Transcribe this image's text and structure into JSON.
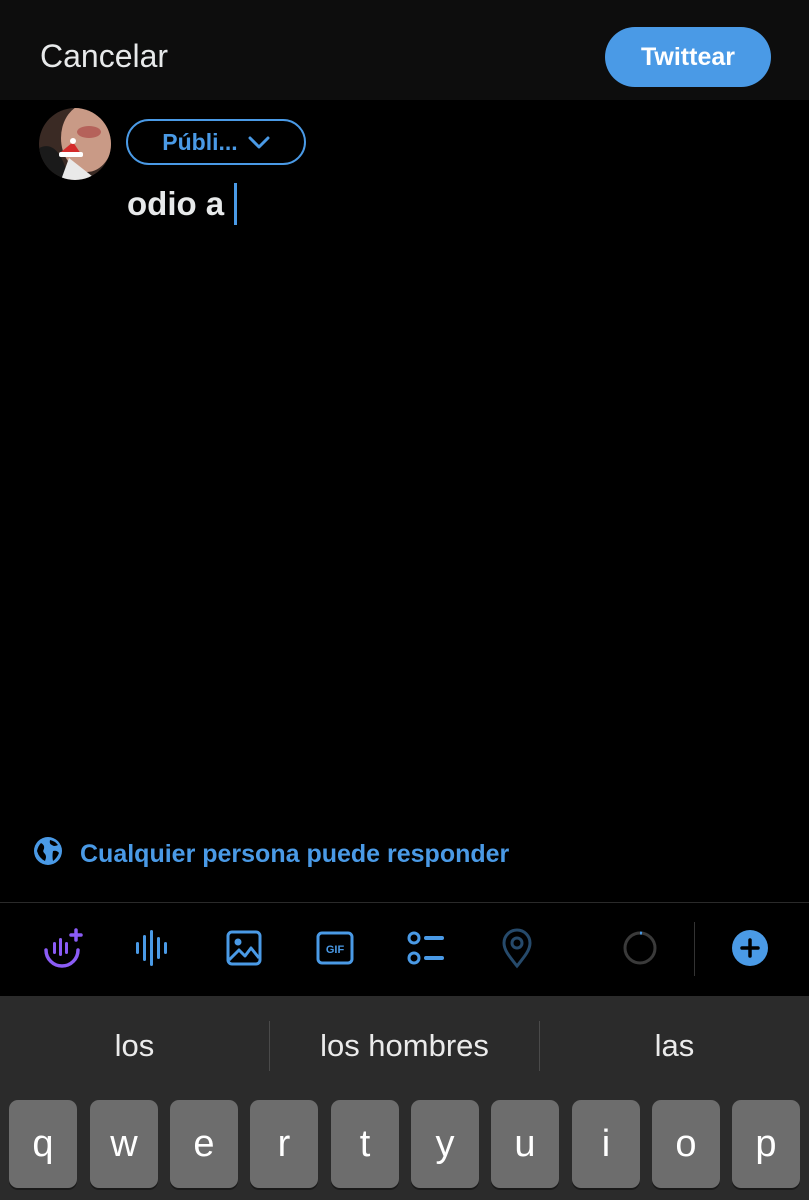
{
  "header": {
    "cancel_label": "Cancelar",
    "tweet_label": "Twittear"
  },
  "composer": {
    "audience_label": "Públi...",
    "text": "odio a"
  },
  "reply_setting": {
    "label": "Cualquier persona puede responder"
  },
  "toolbar": {
    "icons": [
      "spaces-plus-icon",
      "voice-waveform-icon",
      "image-icon",
      "gif-icon",
      "poll-icon",
      "location-pin-icon",
      "character-count-ring-icon",
      "add-tweet-icon"
    ],
    "gif_text": "GIF"
  },
  "keyboard": {
    "suggestions": [
      "los",
      "los hombres",
      "las"
    ],
    "row1": [
      "q",
      "w",
      "e",
      "r",
      "t",
      "y",
      "u",
      "i",
      "o",
      "p"
    ]
  },
  "colors": {
    "accent": "#4a9ae6",
    "background": "#000000",
    "keyboard_bg": "#2b2b2b",
    "key_bg": "#6d6d6d",
    "spaces_purple": "#8b5cf6"
  }
}
